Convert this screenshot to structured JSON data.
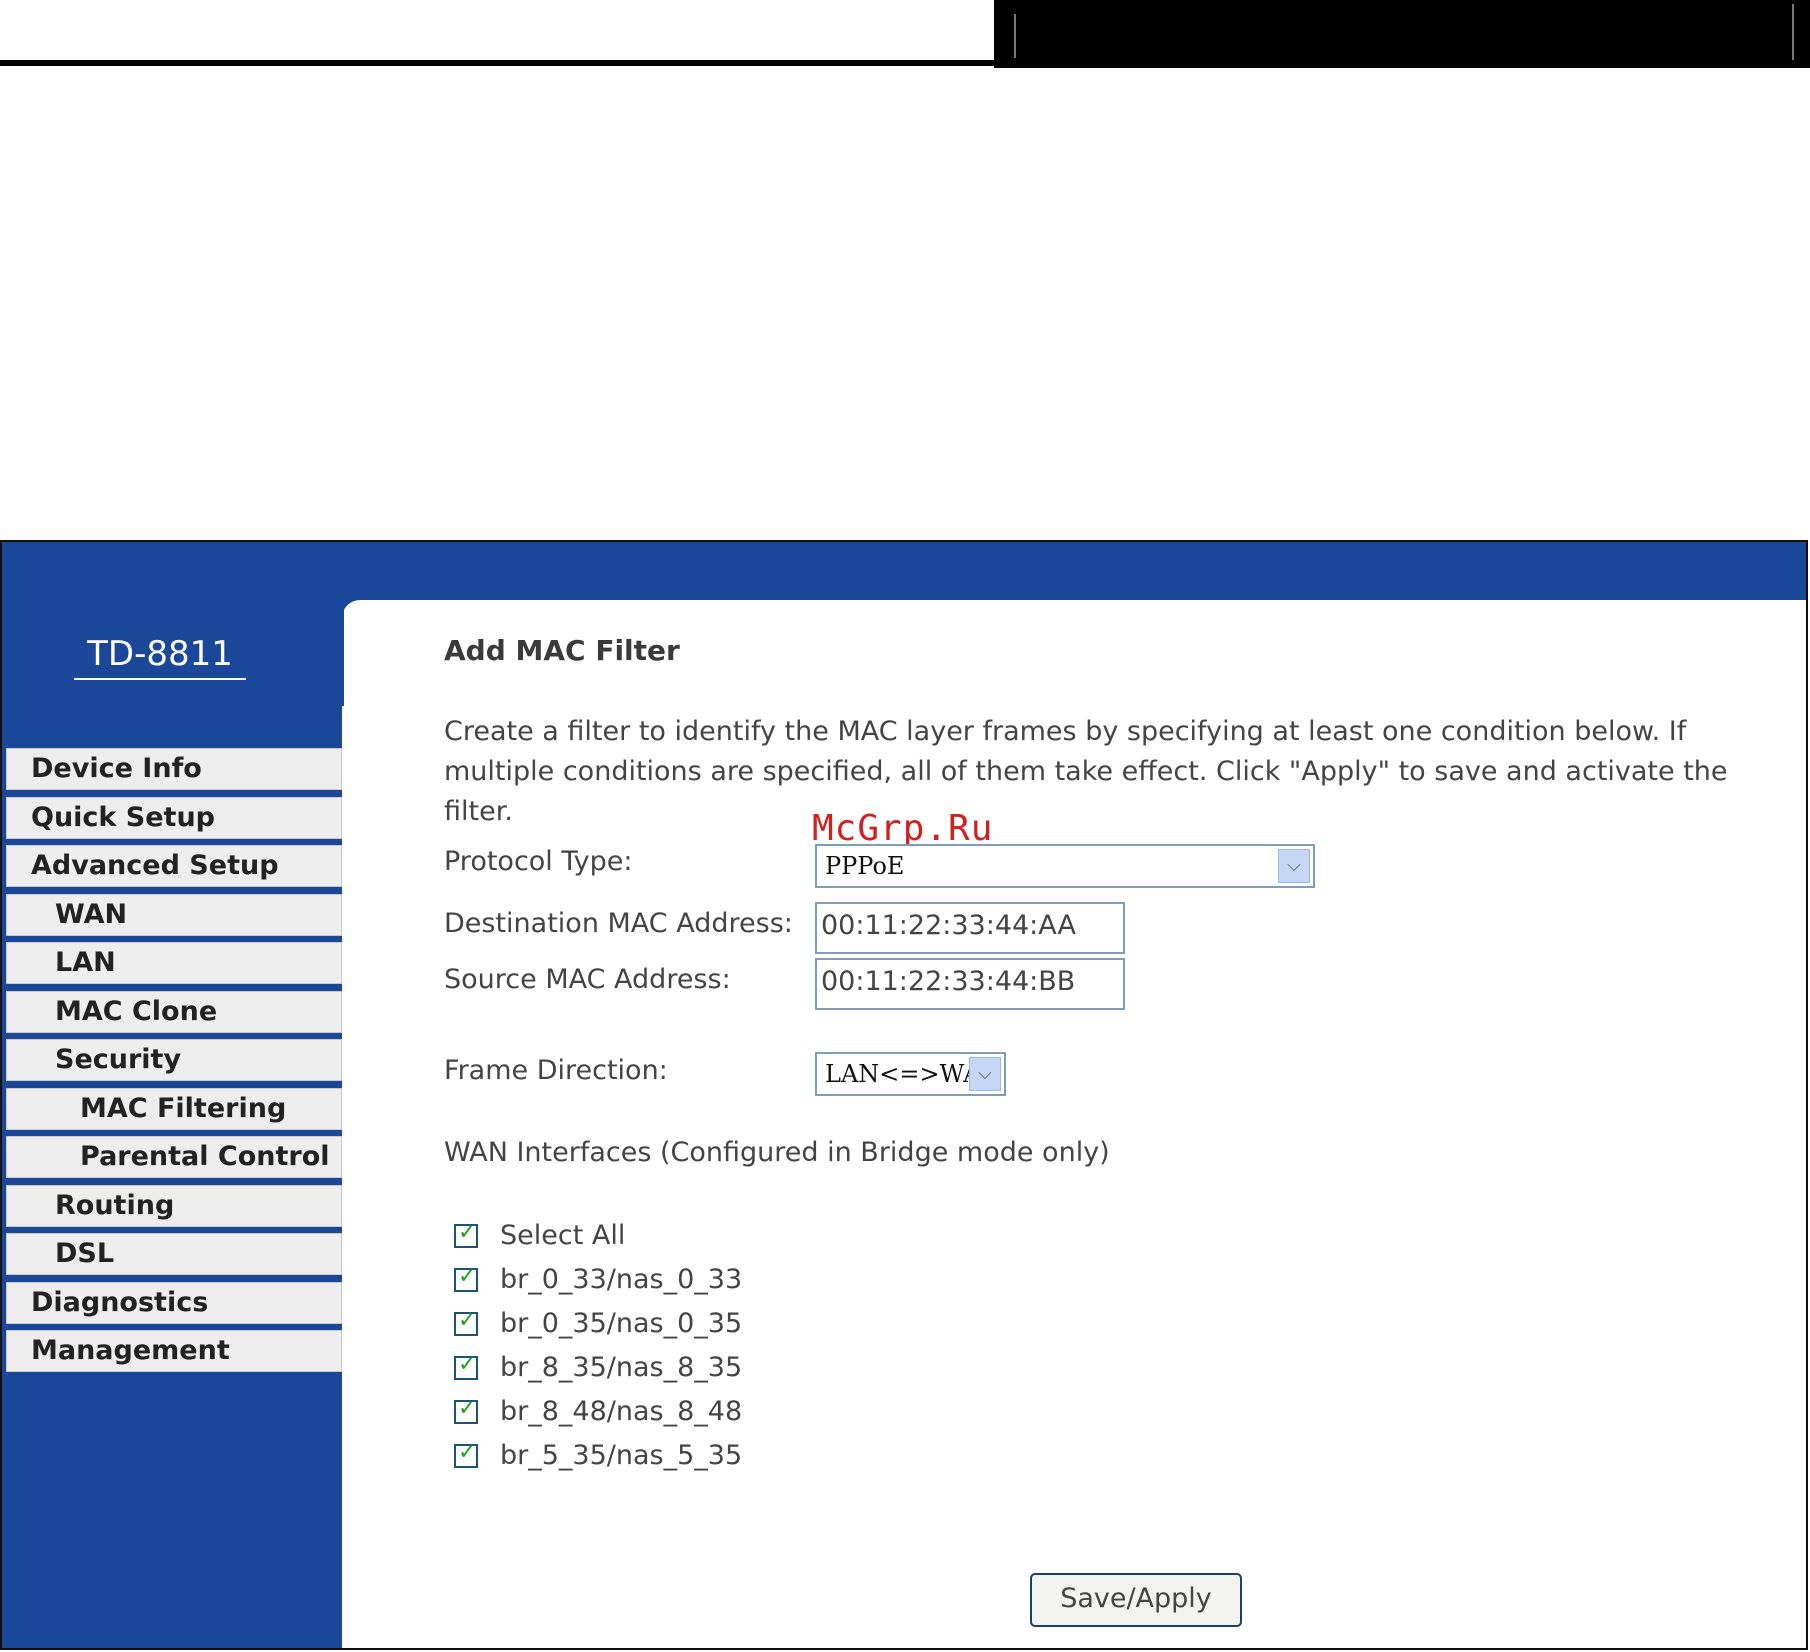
{
  "model": "TD-8811",
  "nav": [
    {
      "label": "Device Info"
    },
    {
      "label": "Quick Setup"
    },
    {
      "label": "Advanced Setup"
    },
    {
      "label": "WAN"
    },
    {
      "label": "LAN"
    },
    {
      "label": "MAC Clone"
    },
    {
      "label": "Security"
    },
    {
      "label": "MAC Filtering"
    },
    {
      "label": "Parental Control"
    },
    {
      "label": "Routing"
    },
    {
      "label": "DSL"
    },
    {
      "label": "Diagnostics"
    },
    {
      "label": "Management"
    }
  ],
  "page": {
    "title": "Add MAC Filter",
    "description": "Create a filter to identify the MAC layer frames by specifying at least one condition below. If multiple conditions are specified, all of them take effect. Click \"Apply\" to save and activate the filter."
  },
  "watermark": "McGrp.Ru",
  "form": {
    "protocol_label": "Protocol Type:",
    "protocol_value": "PPPoE",
    "dest_mac_label": "Destination MAC Address:",
    "dest_mac_value": "00:11:22:33:44:AA",
    "src_mac_label": "Source MAC Address:",
    "src_mac_value": "00:11:22:33:44:BB",
    "direction_label": "Frame Direction:",
    "direction_value": "LAN<=>WAN",
    "wan_label": "WAN Interfaces (Configured in Bridge mode only)",
    "select_all": "Select All",
    "interfaces": [
      "br_0_33/nas_0_33",
      "br_0_35/nas_0_35",
      "br_8_35/nas_8_35",
      "br_8_48/nas_8_48",
      "br_5_35/nas_5_35"
    ],
    "save_label": "Save/Apply"
  },
  "colors": {
    "sidebar": "#1b4799",
    "checkmark": "#21a121",
    "watermark": "#d21f1f"
  }
}
